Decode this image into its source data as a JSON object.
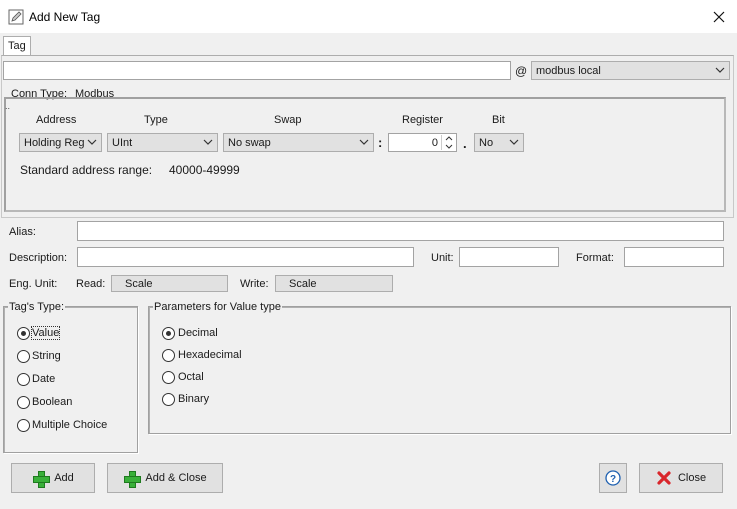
{
  "window": {
    "title": "Add New Tag"
  },
  "tab": {
    "label": "Tag"
  },
  "name_field": {
    "value": "",
    "at_symbol": "@",
    "connection": "modbus local"
  },
  "conn_type": {
    "label": "Conn Type:",
    "value": "Modbus"
  },
  "address_grid": {
    "headers": {
      "address": "Address",
      "type": "Type",
      "swap": "Swap",
      "register": "Register",
      "bit": "Bit"
    },
    "address": "Holding Reg",
    "type": "UInt",
    "swap": "No swap",
    "colon": ":",
    "register": "0",
    "dot": ".",
    "bit": "No",
    "range_label": "Standard address range:",
    "range_value": "40000-49999"
  },
  "alias": {
    "label": "Alias:",
    "value": ""
  },
  "description": {
    "label": "Description:",
    "value": ""
  },
  "unit": {
    "label": "Unit:",
    "value": ""
  },
  "format": {
    "label": "Format:",
    "value": ""
  },
  "eng_unit": {
    "label": "Eng. Unit:",
    "read_label": "Read:",
    "read_button": "Scale",
    "write_label": "Write:",
    "write_button": "Scale"
  },
  "tags_type": {
    "title": "Tag's Type:",
    "options": [
      "Value",
      "String",
      "Date",
      "Boolean",
      "Multiple Choice"
    ],
    "selected": "Value"
  },
  "value_params": {
    "title": "Parameters for Value type",
    "options": [
      "Decimal",
      "Hexadecimal",
      "Octal",
      "Binary"
    ],
    "selected": "Decimal"
  },
  "buttons": {
    "add": "Add",
    "add_close": "Add & Close",
    "help": "?",
    "close": "Close"
  },
  "colors": {
    "accent_blue": "#1e60b0",
    "green_plus": "#3ab03a",
    "red_x": "#d9262b"
  }
}
